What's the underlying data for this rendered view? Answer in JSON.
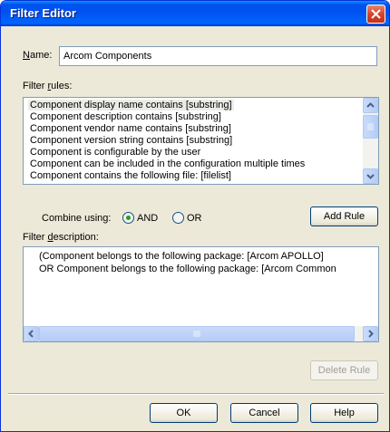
{
  "window": {
    "title": "Filter Editor"
  },
  "name_field": {
    "label": "Name:",
    "value": "Arcom Components"
  },
  "filter_rules": {
    "label": "Filter rules:",
    "items": [
      "Component display name contains [substring]",
      "Component description contains [substring]",
      "Component vendor name contains [substring]",
      "Component version string contains [substring]",
      "Component is configurable by the user",
      "Component can be included in the configuration multiple times",
      "Component contains the following file: [filelist]"
    ],
    "selected_index": 0
  },
  "combine": {
    "label": "Combine using:",
    "options": [
      "AND",
      "OR"
    ],
    "selected": "AND"
  },
  "buttons": {
    "add_rule": "Add Rule",
    "delete_rule": "Delete Rule",
    "ok": "OK",
    "cancel": "Cancel",
    "help": "Help"
  },
  "filter_description": {
    "label": "Filter description:",
    "lines": [
      "(Component belongs to the following package: [Arcom APOLLO]",
      "OR    Component belongs to the following package: [Arcom Common"
    ]
  },
  "icons": {
    "close": "close-icon",
    "scroll_up": "scroll-up-arrow-icon",
    "scroll_down": "scroll-down-arrow-icon",
    "scroll_left": "scroll-left-arrow-icon",
    "scroll_right": "scroll-right-arrow-icon"
  },
  "colors": {
    "titlebar": "#0053ee",
    "dialog_bg": "#ece9d8",
    "close_button": "#d6452c",
    "radio_dot": "#21a121"
  }
}
